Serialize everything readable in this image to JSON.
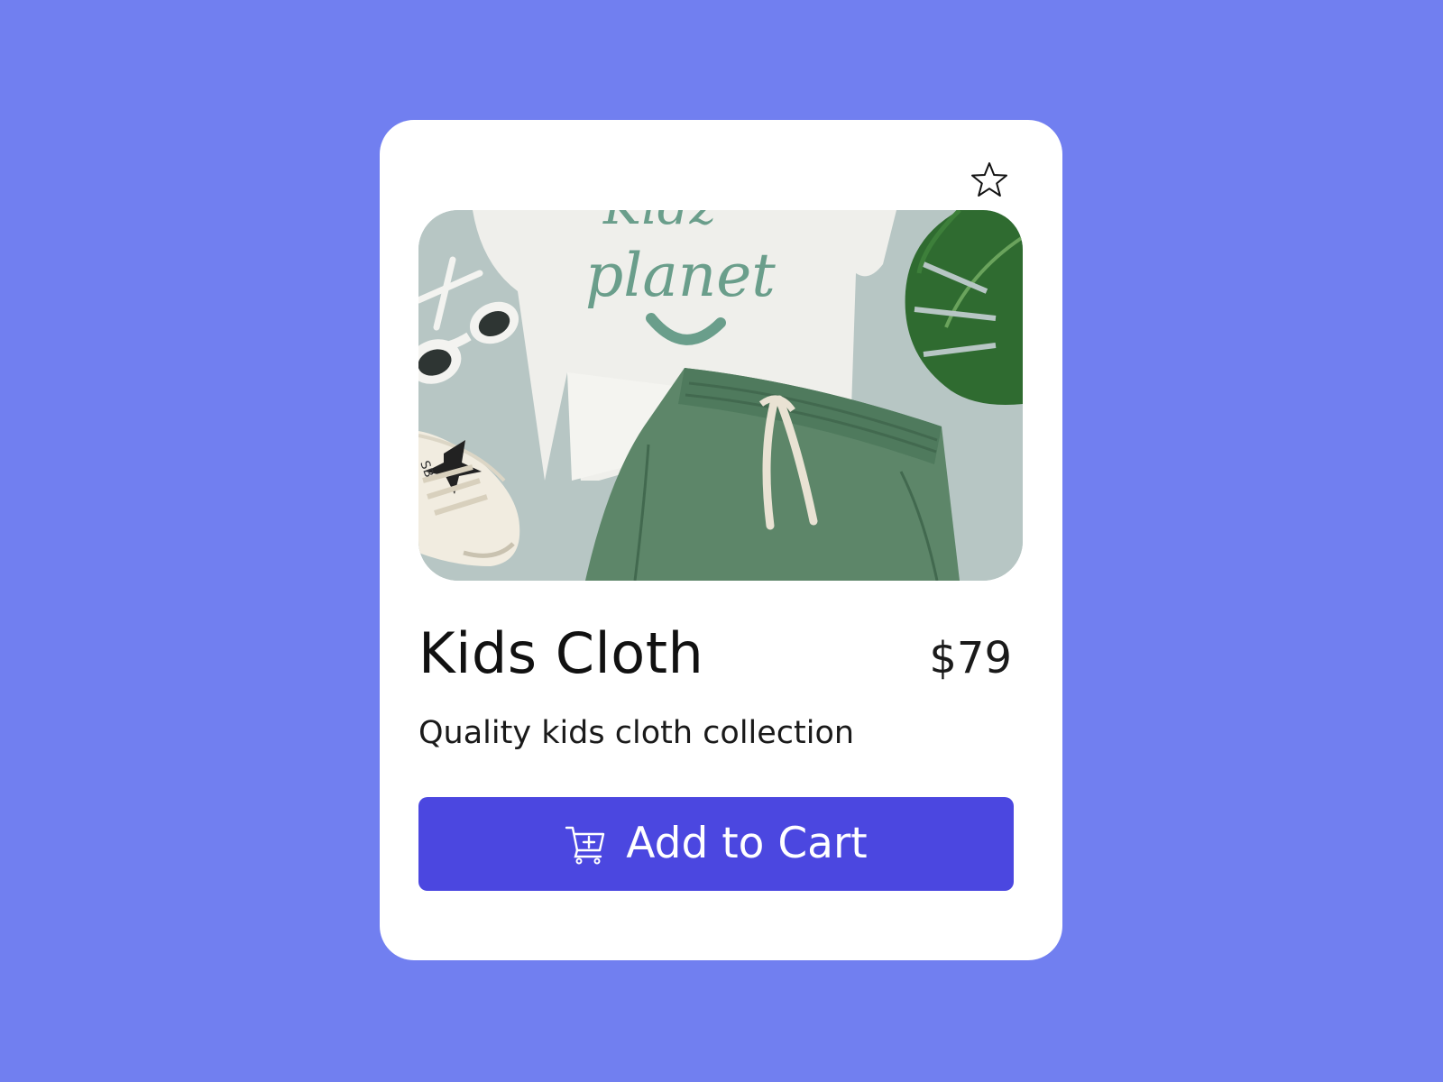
{
  "product": {
    "name": "Kids Cloth",
    "price": "$79",
    "description": "Quality kids cloth collection",
    "image_alt": "Kids outfit flat lay with t-shirt, green shorts, sunglasses, sneaker and palm leaf",
    "shirt_print": "planet",
    "favorited": false
  },
  "actions": {
    "add_to_cart_label": "Add to Cart",
    "add_to_cart_icon": "cart-plus-icon",
    "favorite_icon": "star-outline-icon"
  },
  "colors": {
    "background": "#717ff0",
    "card": "#ffffff",
    "button": "#4b47e0",
    "button_text": "#ffffff",
    "text": "#111111"
  }
}
